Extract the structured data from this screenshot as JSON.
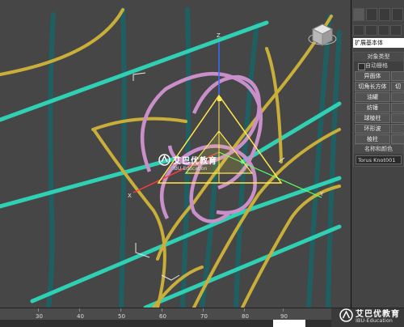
{
  "viewport": {
    "axis_labels": {
      "z": "Z",
      "x": "X",
      "y": "Y"
    },
    "colors": {
      "background": "#464646",
      "teal": "#2fd0b3",
      "gold": "#c9ae3a",
      "pink": "#c98fc9",
      "gizmo": "#ffe84d",
      "dark_teal": "#1f5f62"
    }
  },
  "watermark": {
    "title": "艾巴优教育",
    "subtitle": "IBU-Education"
  },
  "command_panel": {
    "category_dropdown": "扩展基本体",
    "object_type": {
      "header": "对象类型",
      "autogrid": "自动栅格",
      "buttons": [
        "异面体",
        "",
        "切角长方体",
        "切",
        "油罐",
        "",
        "纺锤",
        "",
        "球棱柱",
        "",
        "环形波",
        "",
        "棱柱",
        ""
      ]
    },
    "name_color": {
      "header": "名称和颜色",
      "name": "Torus Knot001"
    }
  },
  "timeline": {
    "ticks": [
      "30",
      "40",
      "50",
      "60",
      "70",
      "80",
      "90"
    ]
  }
}
